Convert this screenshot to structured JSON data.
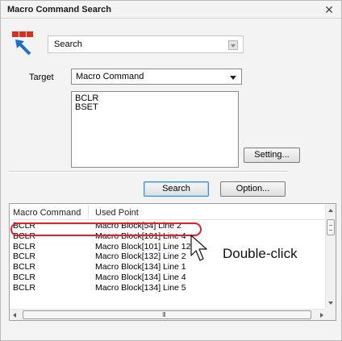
{
  "window": {
    "title": "Macro Command Search",
    "close_icon": "close-icon"
  },
  "search_mode": {
    "value": "Search",
    "icon": "macro-search-icon"
  },
  "target": {
    "label": "Target",
    "value": "Macro Command"
  },
  "command_list": [
    "BCLR",
    "BSET"
  ],
  "buttons": {
    "setting": "Setting...",
    "search": "Search",
    "option": "Option..."
  },
  "results": {
    "columns": [
      "Macro Command",
      "Used Point"
    ],
    "rows": [
      {
        "command": "BCLR",
        "point": "Macro Block[54] Line 2"
      },
      {
        "command": "BCLR",
        "point": "Macro Block[101] Line 4"
      },
      {
        "command": "BCLR",
        "point": "Macro Block[101] Line 12"
      },
      {
        "command": "BCLR",
        "point": "Macro Block[132] Line 2"
      },
      {
        "command": "BCLR",
        "point": "Macro Block[134] Line 1"
      },
      {
        "command": "BCLR",
        "point": "Macro Block[134] Line 4"
      },
      {
        "command": "BCLR",
        "point": "Macro Block[134] Line 5"
      }
    ],
    "hscroll_grip": "III"
  },
  "annotation": {
    "callout": "Double-click",
    "highlight_color": "#e4202f"
  },
  "colors": {
    "default_button_border": "#3a8edb"
  }
}
